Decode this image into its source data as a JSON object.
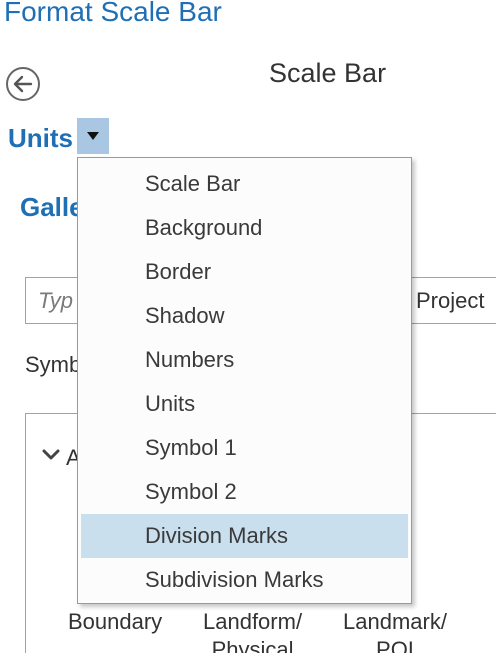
{
  "pane": {
    "title": "Format Scale Bar"
  },
  "header": {
    "element_title": "Scale Bar",
    "back_icon": "back-arrow-icon"
  },
  "units": {
    "label": "Units",
    "dropdown_icon": "triangle-down-icon"
  },
  "gallery": {
    "label": "Galle",
    "search_placeholder": "Typ",
    "scope": "Project",
    "symbology_label": "Symb",
    "group_label": "A",
    "categories": [
      {
        "line1": "Boundary",
        "line2": ""
      },
      {
        "line1": "Landform/",
        "line2": "Physical"
      },
      {
        "line1": "Landmark/",
        "line2": "POI"
      }
    ]
  },
  "menu": {
    "items": [
      "Scale Bar",
      "Background",
      "Border",
      "Shadow",
      "Numbers",
      "Units",
      "Symbol 1",
      "Symbol 2",
      "Division Marks",
      "Subdivision Marks"
    ],
    "selected": "Division Marks"
  },
  "colors": {
    "accent": "#1f6fb5",
    "selection": "#cadfee",
    "dropdown": "#a9c6e2"
  }
}
